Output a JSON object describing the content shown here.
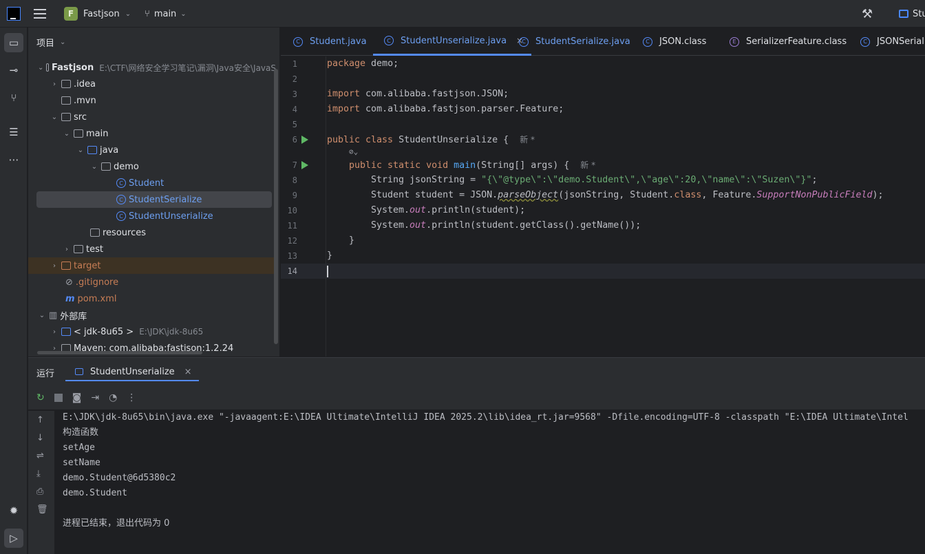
{
  "titlebar": {
    "project_letter": "F",
    "project_name": "Fastjson",
    "branch": "main",
    "right_tab": "Stu"
  },
  "project_panel": {
    "title": "项目",
    "tree": [
      {
        "label": "Fastjson",
        "path": "E:\\CTF\\网络安全学习笔记\\漏洞\\Java安全\\JavaS"
      },
      {
        "label": ".idea"
      },
      {
        "label": ".mvn"
      },
      {
        "label": "src"
      },
      {
        "label": "main"
      },
      {
        "label": "java"
      },
      {
        "label": "demo"
      },
      {
        "label": "Student"
      },
      {
        "label": "StudentSerialize"
      },
      {
        "label": "StudentUnserialize"
      },
      {
        "label": "resources"
      },
      {
        "label": "test"
      },
      {
        "label": "target"
      },
      {
        "label": ".gitignore"
      },
      {
        "label": "pom.xml"
      },
      {
        "label": "外部库"
      },
      {
        "label": "< jdk-8u65 >",
        "path": "E:\\JDK\\jdk-8u65"
      },
      {
        "label": "Maven: com.alibaba:fastjson:1.2.24"
      }
    ]
  },
  "editor_tabs": [
    {
      "label": "Student.java"
    },
    {
      "label": "StudentUnserialize.java",
      "close": "×"
    },
    {
      "label": "StudentSerialize.java"
    },
    {
      "label": "JSON.class"
    },
    {
      "label": "SerializerFeature.class"
    },
    {
      "label": "JSONSerialize"
    }
  ],
  "editor": {
    "line_numbers": [
      "1",
      "2",
      "3",
      "4",
      "5",
      "6",
      "7",
      "8",
      "9",
      "10",
      "11",
      "12",
      "13",
      "14"
    ],
    "hint_new": "新 *",
    "lines": {
      "l1": "package demo;",
      "l3": "import com.alibaba.fastjson.JSON;",
      "l4": "import com.alibaba.fastjson.parser.Feature;",
      "l6_kw": "public class",
      "l6_rest": " StudentUnserialize {",
      "l7_kw": "public static void",
      "l7_fn": "main",
      "l7_rest": "(String[] args) {",
      "l8_a": "String jsonString = ",
      "l8_b": "\"{\\\"@type\\\":\\\"demo.Student\\\",\\\"age\\\":20,\\\"name\\\":\\\"Suzen\\\"}\"",
      "l8_c": ";",
      "l9_a": "Student student = JSON.",
      "l9_fn": "parseObject",
      "l9_b": "(jsonString, Student.",
      "l9_kw": "class",
      "l9_c": ", Feature.",
      "l9_field": "SupportNonPublicField",
      "l9_d": ");",
      "l10_a": "System.",
      "l10_out": "out",
      "l10_b": ".println(student);",
      "l11_a": "System.",
      "l11_out": "out",
      "l11_b": ".println(student.getClass().getName());",
      "l12": "}",
      "l13": "}"
    }
  },
  "run_panel": {
    "title": "运行",
    "tab": "StudentUnserialize",
    "output": [
      "E:\\JDK\\jdk-8u65\\bin\\java.exe \"-javaagent:E:\\IDEA Ultimate\\IntelliJ IDEA 2025.2\\lib\\idea_rt.jar=9568\" -Dfile.encoding=UTF-8 -classpath \"E:\\IDEA Ultimate\\Intel",
      "构造函数",
      "setAge",
      "setName",
      "demo.Student@6d5380c2",
      "demo.Student",
      "",
      "进程已结束，退出代码为 0"
    ]
  }
}
